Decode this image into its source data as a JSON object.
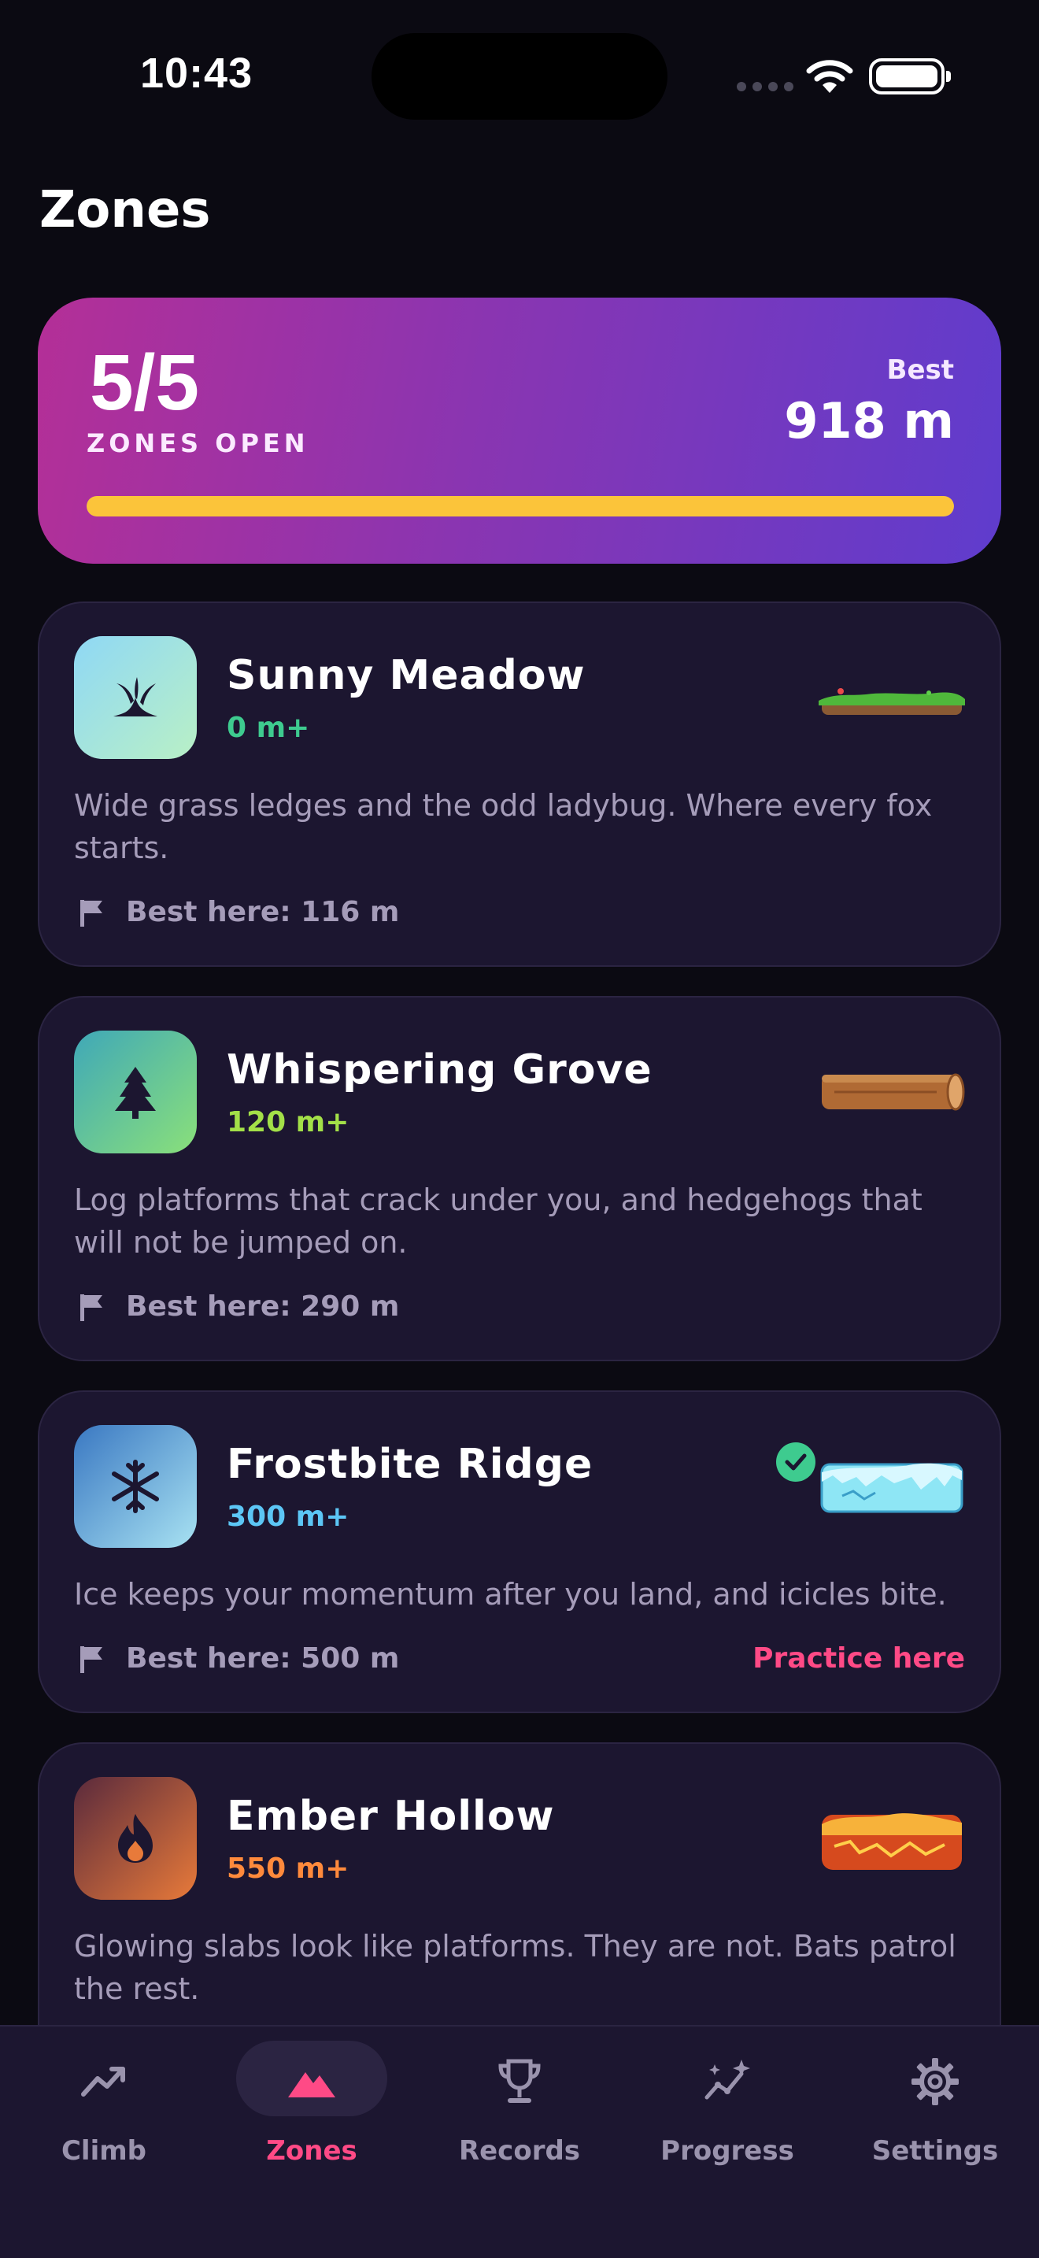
{
  "status_bar": {
    "time": "10:43"
  },
  "page": {
    "title": "Zones"
  },
  "summary": {
    "count": "5/5",
    "count_label": "ZONES OPEN",
    "best_label": "Best",
    "best_value": "918 m",
    "progress": 1.0,
    "progress_color": "#fbc43a"
  },
  "zones": [
    {
      "name": "Sunny Meadow",
      "requirement": "0 m+",
      "requirement_color": "#3ecb8f",
      "description": "Wide grass ledges and the odd ladybug. Where every fox starts.",
      "best": "Best here: 116 m",
      "icon": "grass-icon",
      "platform": "grass-platform"
    },
    {
      "name": "Whispering Grove",
      "requirement": "120 m+",
      "requirement_color": "#a3e048",
      "description": "Log platforms that crack under you, and hedgehogs that will not be jumped on.",
      "best": "Best here: 290 m",
      "icon": "tree-icon",
      "platform": "log-platform"
    },
    {
      "name": "Frostbite Ridge",
      "requirement": "300 m+",
      "requirement_color": "#5cc6f5",
      "description": "Ice keeps your momentum after you land, and icicles bite.",
      "best": "Best here: 500 m",
      "action": "Practice here",
      "icon": "snowflake-icon",
      "platform": "ice-platform",
      "completed": true
    },
    {
      "name": "Ember Hollow",
      "requirement": "550 m+",
      "requirement_color": "#ff8a3c",
      "description": "Glowing slabs look like platforms. They are not. Bats patrol the rest.",
      "icon": "fire-icon",
      "platform": "lava-platform"
    }
  ],
  "tabs": [
    {
      "label": "Climb",
      "icon": "trend-up-icon",
      "active": false
    },
    {
      "label": "Zones",
      "icon": "mountain-icon",
      "active": true
    },
    {
      "label": "Records",
      "icon": "trophy-icon",
      "active": false
    },
    {
      "label": "Progress",
      "icon": "sparkle-chart-icon",
      "active": false
    },
    {
      "label": "Settings",
      "icon": "gear-icon",
      "active": false
    }
  ],
  "accent_color": "#ff4a86"
}
